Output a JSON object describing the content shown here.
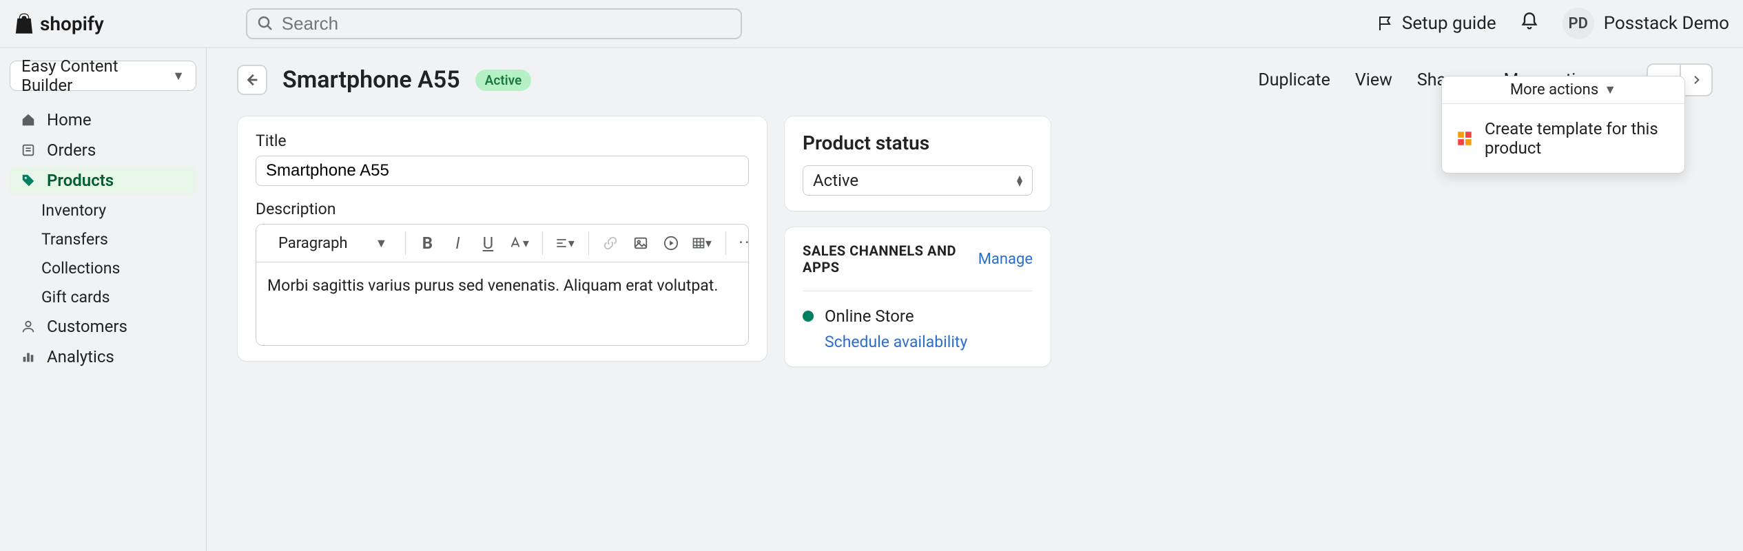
{
  "colors": {
    "accent": "#008060",
    "link": "#2c6ecb"
  },
  "topbar": {
    "brand": "shopify",
    "search_placeholder": "Search",
    "setup_guide_label": "Setup guide",
    "avatar_initials": "PD",
    "user_name": "Posstack Demo"
  },
  "sidebar": {
    "app_select_label": "Easy Content Builder",
    "items": [
      {
        "icon": "home-icon",
        "label": "Home"
      },
      {
        "icon": "orders-icon",
        "label": "Orders"
      },
      {
        "icon": "products-icon",
        "label": "Products",
        "selected": true,
        "children": [
          {
            "label": "Inventory"
          },
          {
            "label": "Transfers"
          },
          {
            "label": "Collections"
          },
          {
            "label": "Gift cards"
          }
        ]
      },
      {
        "icon": "customers-icon",
        "label": "Customers"
      },
      {
        "icon": "analytics-icon",
        "label": "Analytics"
      }
    ]
  },
  "page": {
    "title": "Smartphone A55",
    "status_badge": "Active",
    "actions": {
      "duplicate": "Duplicate",
      "view": "View",
      "share": "Share",
      "more_actions": "More actions"
    },
    "dropdown": {
      "more_actions_label": "More actions",
      "create_template": "Create template for this product"
    },
    "title_section": {
      "label": "Title",
      "value": "Smartphone A55"
    },
    "description_section": {
      "label": "Description",
      "paragraph_label": "Paragraph",
      "content": "Morbi sagittis varius purus sed venenatis. Aliquam erat volutpat."
    },
    "status_card": {
      "heading": "Product status",
      "select_value": "Active"
    },
    "channels_card": {
      "heading": "SALES CHANNELS AND APPS",
      "manage_label": "Manage",
      "channel_name": "Online Store",
      "schedule_label": "Schedule availability"
    }
  }
}
